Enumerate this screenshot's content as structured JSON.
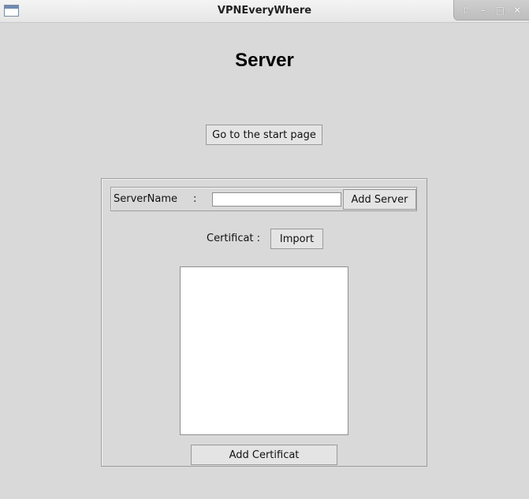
{
  "window": {
    "title": "VPNEveryWhere",
    "controls": {
      "restore": "⇧",
      "minimize": "–",
      "maximize": "□",
      "close": "✕"
    }
  },
  "page": {
    "title": "Server"
  },
  "nav": {
    "start_page_label": "Go to the start page"
  },
  "server": {
    "name_label": "ServerName",
    "name_colon": ":",
    "name_value": "",
    "add_label": "Add Server"
  },
  "certificate": {
    "label": "Certificat :",
    "import_label": "Import",
    "add_label": "Add Certificat"
  }
}
